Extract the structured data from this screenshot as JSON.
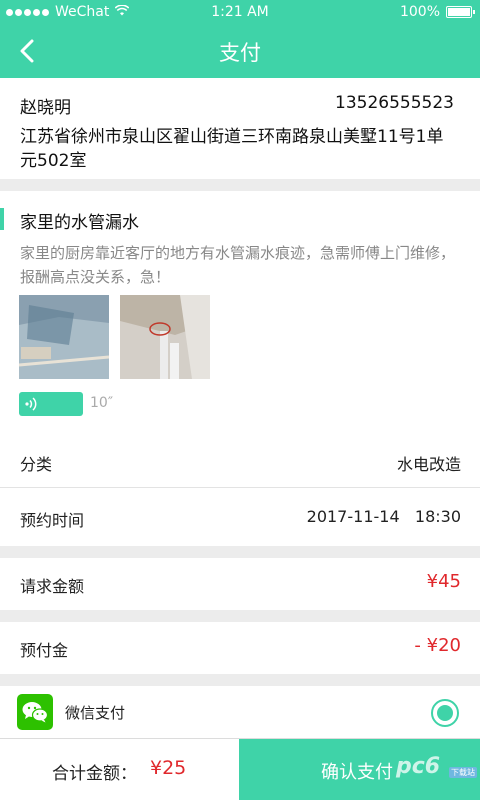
{
  "status_bar": {
    "carrier": "WeChat",
    "time": "1:21 AM",
    "battery": "100%"
  },
  "nav": {
    "title": "支付"
  },
  "address": {
    "name": "赵晓明",
    "phone": "13526555523",
    "detail": "江苏省徐州市泉山区翟山街道三环南路泉山美墅11号1单元502室"
  },
  "task": {
    "title": "家里的水管漏水",
    "description": "家里的厨房靠近客厅的地方有水管漏水痕迹，急需师傅上门维修，报酬高点没关系，急！",
    "voice_duration": "10″"
  },
  "details": {
    "category_label": "分类",
    "category_value": "水电改造",
    "time_label": "预约时间",
    "time_value": "2017-11-14   18:30"
  },
  "amounts": {
    "request_label": "请求金额",
    "request_value": "¥45",
    "prepay_label": "预付金",
    "prepay_value": "- ¥20"
  },
  "payment": {
    "method_label": "微信支付"
  },
  "footer": {
    "total_label": "合计金额：",
    "total_value": "¥25",
    "confirm_label": "确认支付"
  },
  "watermark": {
    "text": "pc6",
    "sub": "下载站"
  },
  "colors": {
    "accent": "#3fd3a8",
    "price_red": "#e0282c",
    "wechat_green": "#2dc100"
  }
}
